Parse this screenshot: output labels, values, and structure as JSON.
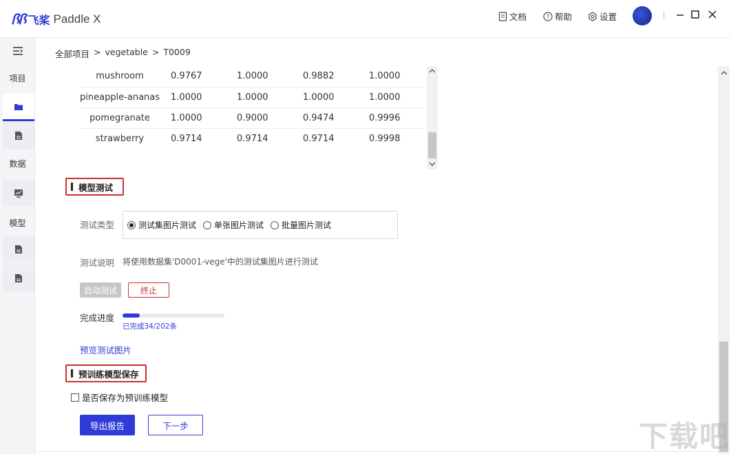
{
  "app": {
    "logo_mark": "ꟗꟗ",
    "logo_cn": "飞桨",
    "logo_en": "Paddle X"
  },
  "topbar": {
    "docs_label": "文档",
    "help_label": "帮助",
    "settings_label": "设置"
  },
  "sidebar": {
    "project_label": "项目",
    "data_label": "数据",
    "model_label": "模型"
  },
  "breadcrumb": [
    "全部项目",
    ">",
    "vegetable",
    ">",
    "T0009"
  ],
  "table": {
    "rows": [
      [
        "mushroom",
        "0.9767",
        "1.0000",
        "0.9882",
        "1.0000"
      ],
      [
        "pineapple-ananas",
        "1.0000",
        "1.0000",
        "1.0000",
        "1.0000"
      ],
      [
        "pomegranate",
        "1.0000",
        "0.9000",
        "0.9474",
        "0.9996"
      ],
      [
        "strawberry",
        "0.9714",
        "0.9714",
        "0.9714",
        "0.9998"
      ]
    ]
  },
  "test_section": {
    "title": "模型测试",
    "type_label": "测试类型",
    "options": [
      "测试集图片测试",
      "单张图片测试",
      "批量图片测试"
    ],
    "selected_index": 0,
    "desc_label": "测试说明",
    "desc_text": "将使用数据集'D0001-vege'中的测试集图片进行测试",
    "start_label": "启动测试",
    "stop_label": "终止",
    "progress_label": "完成进度",
    "progress_fraction": 0.168,
    "progress_text": "已完成34/202条",
    "preview_link": "预览测试图片"
  },
  "pretrain_section": {
    "title": "预训练模型保存",
    "checkbox_label": "是否保存为预训练模型",
    "checked": false
  },
  "actions": {
    "export_label": "导出报告",
    "next_label": "下一步"
  },
  "watermark": "下载吧",
  "colors": {
    "accent": "#2f3bd8",
    "danger": "#c9302c"
  }
}
